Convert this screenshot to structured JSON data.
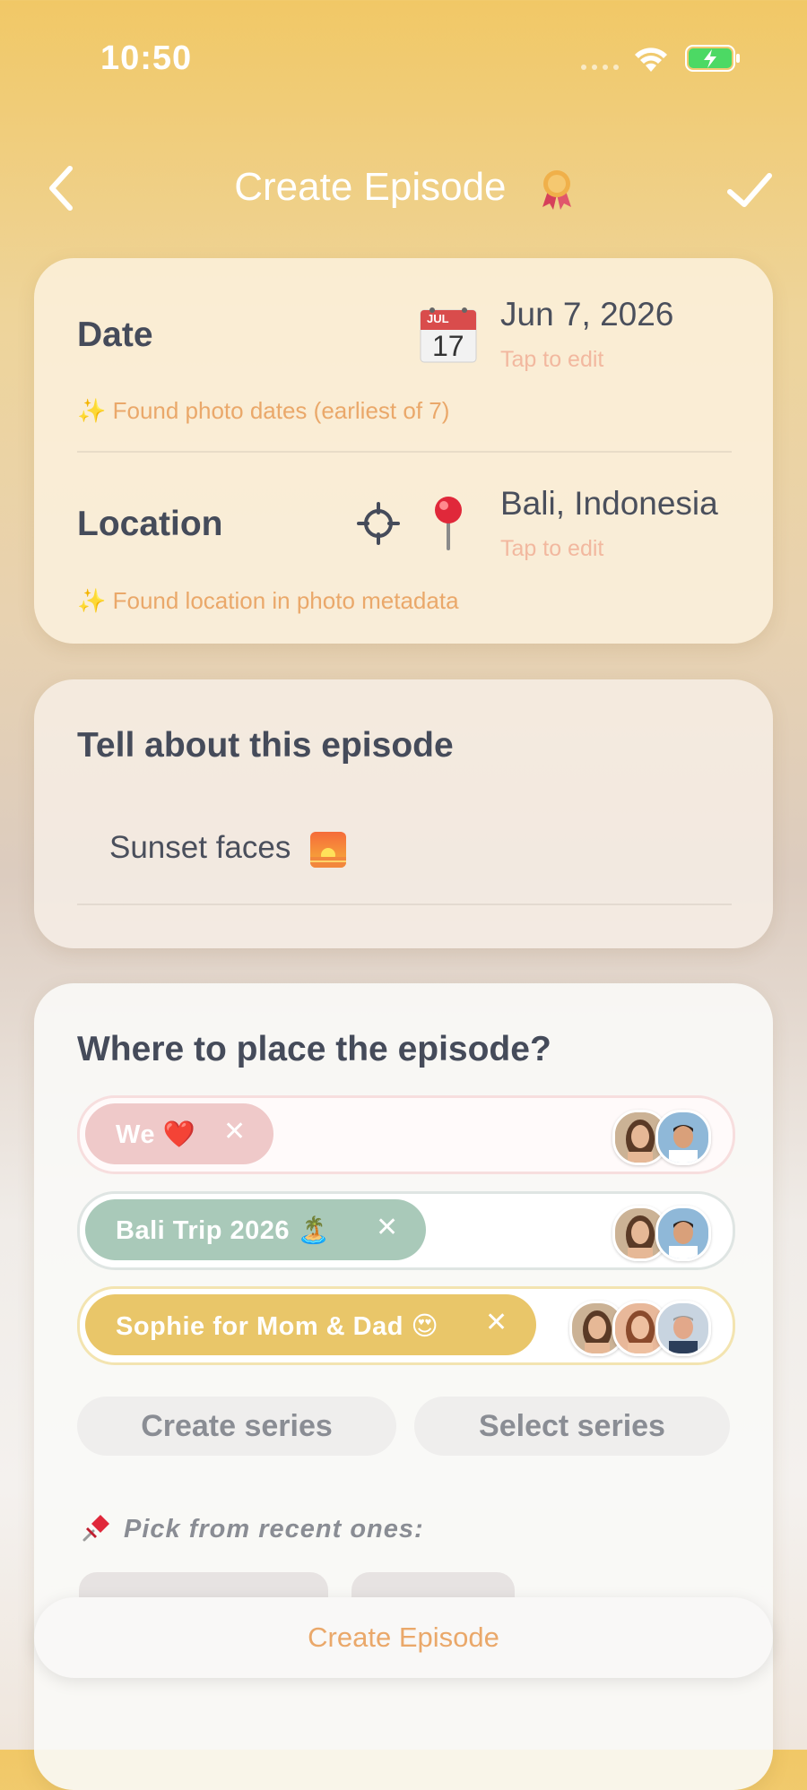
{
  "status_bar": {
    "time": "10:50"
  },
  "nav": {
    "title": "Create Episode"
  },
  "date_section": {
    "label": "Date",
    "calendar_month": "JUL",
    "calendar_day": "17",
    "value": "Jun 7, 2026",
    "tap_to_edit": "Tap to edit",
    "hint": "✨ Found photo dates (earliest of 7)"
  },
  "location_section": {
    "label": "Location",
    "value": "Bali, Indonesia",
    "tap_to_edit": "Tap to edit",
    "hint": "✨ Found location in photo metadata"
  },
  "episode_section": {
    "title": "Tell about this episode",
    "text": "Sunset faces"
  },
  "series_section": {
    "title": "Where to place the episode?",
    "rows": [
      {
        "label": "We ❤️",
        "remove": "✕",
        "avatar_count": 2
      },
      {
        "label": "Bali Trip 2026 🏝️",
        "remove": "✕",
        "avatar_count": 2
      },
      {
        "label": "Sophie for Mom & Dad 😍",
        "remove": "✕",
        "avatar_count": 3
      }
    ],
    "create_series": "Create series",
    "select_series": "Select series",
    "recent_label": "Pick from recent ones:"
  },
  "bottom_button": {
    "label": "Create Episode"
  },
  "colors": {
    "accent_orange": "#eaa86a",
    "chip_we": "#efc9c9",
    "chip_bali": "#a9c9b9",
    "chip_sophie": "#e9c669",
    "text_dark": "#454b5a"
  }
}
